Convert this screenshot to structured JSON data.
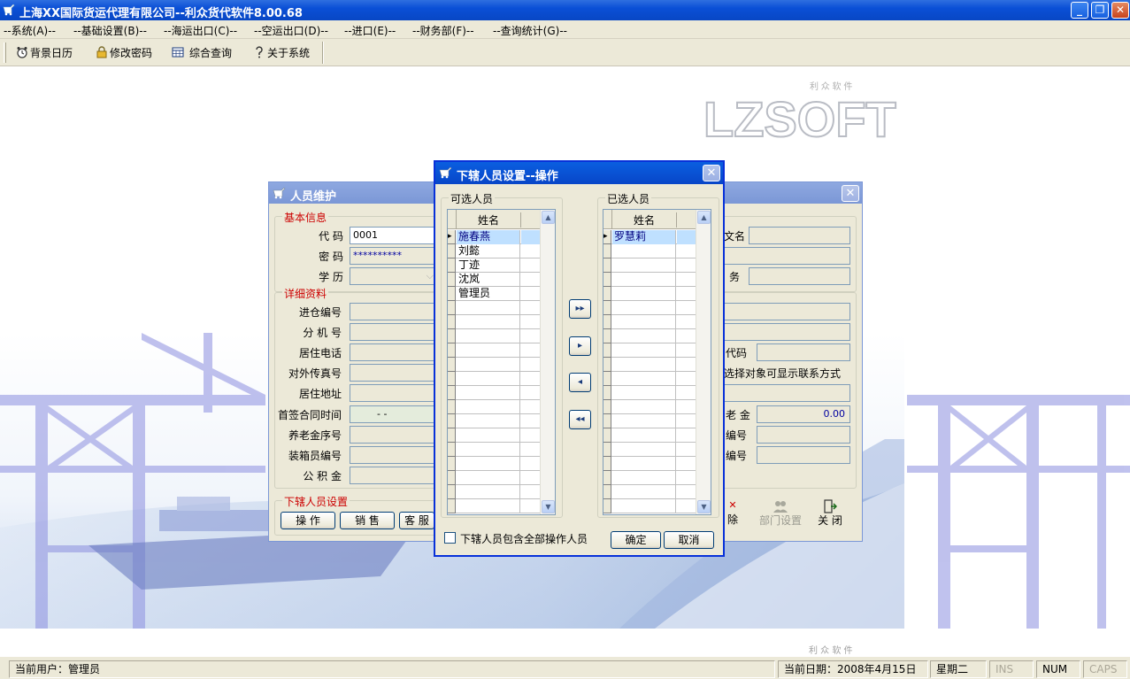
{
  "app": {
    "title": "上海XX国际货运代理有限公司--利众货代软件8.00.68",
    "window_buttons": {
      "minimize": "_",
      "restore": "❐",
      "close": "✕"
    }
  },
  "menu": [
    "--系统(A)--",
    "--基础设置(B)--",
    "--海运出口(C)--",
    "--空运出口(D)--",
    "--进口(E)--",
    "--财务部(F)--",
    "--查询统计(G)--"
  ],
  "toolbar": [
    {
      "label": "背景日历",
      "icon": "alarm-clock-icon"
    },
    {
      "label": "修改密码",
      "icon": "lock-icon"
    },
    {
      "label": "综合查询",
      "icon": "calculator-icon"
    },
    {
      "label": "关于系统",
      "icon": "help-icon"
    }
  ],
  "logo": {
    "text": "LZSOFT",
    "tagline": "利 众 软 件"
  },
  "personnel_window": {
    "title": "人员维护",
    "basic_group": "基本信息",
    "detail_group": "详细资料",
    "sub_group": "下辖人员设置",
    "labels": {
      "code": "代  码",
      "password": "密  码",
      "education": "学  历",
      "warehouse_no": "进仓编号",
      "extension": "分 机 号",
      "home_phone": "居住电话",
      "fax": "对外传真号",
      "address": "居住地址",
      "contract_date": "首签合同时间",
      "pension_no": "养老金序号",
      "packer_no": "装箱员编号",
      "fund": "公 积 金"
    },
    "values": {
      "code": "0001",
      "password": "**********",
      "contract_date": "-  -"
    },
    "right_labels": {
      "english_name_partial": "文名",
      "duty_partial": "务",
      "code_partial": "代码",
      "contact_note": "选择对象可显示联系方式",
      "pension_partial": "老 金",
      "number_partial_1": "编号",
      "number_partial_2": "编号"
    },
    "right_values": {
      "pension_amount": "0.00"
    },
    "sub_buttons": [
      "操 作",
      "销 售",
      "客 服"
    ],
    "action_buttons": {
      "delete": "除",
      "dept": "部门设置",
      "close": "关 闭"
    }
  },
  "subordinate_dialog": {
    "title": "下辖人员设置--操作",
    "available_label": "可选人员",
    "selected_label": "已选人员",
    "column_header": "姓名",
    "available": [
      "施春燕",
      "刘懿",
      "丁迹",
      "沈岚",
      "管理员"
    ],
    "selected": [
      "罗慧莉"
    ],
    "move_buttons": {
      "all_right": "▸▸",
      "right": "▸",
      "left": "◂",
      "all_left": "◂◂"
    },
    "checkbox_label": "下辖人员包含全部操作人员",
    "ok": "确定",
    "cancel": "取消"
  },
  "status": {
    "user": "当前用户：管理员",
    "date": "当前日期：2008年4月15日",
    "weekday": "星期二",
    "ins": "INS",
    "num": "NUM",
    "caps": "CAPS",
    "bottom_tagline": "利 众 软 件"
  }
}
